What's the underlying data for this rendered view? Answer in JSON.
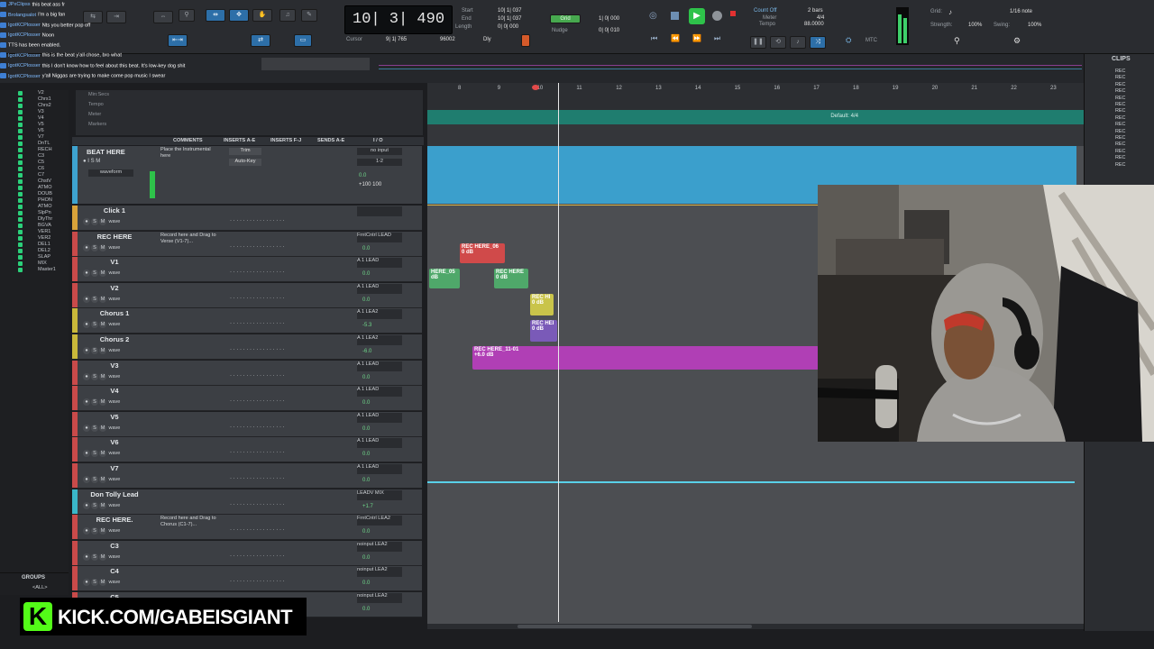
{
  "chat": [
    {
      "user": "JPxClipss",
      "msg": "this beat ass fr"
    },
    {
      "user": "Brolangsalot",
      "msg": "I'm a big fan"
    },
    {
      "user": "IgotKCPlosser",
      "msg": "Nts you better pop off"
    },
    {
      "user": "IgotKCPlosser",
      "msg": "Noon"
    },
    {
      "user": "",
      "msg": "TTS has been enabled."
    },
    {
      "user": "IgotKCPlosser",
      "msg": "this is the beat y'all chose, bro what"
    },
    {
      "user": "IgotKCPlosser",
      "msg": "this I don't know how to feel about this beat. It's low-key dog shit"
    },
    {
      "user": "IgotKCPlosser",
      "msg": "y'all Niggas are trying to make come pop music I swear"
    }
  ],
  "toolbar": {
    "counter_main": "10| 3| 490",
    "start_label": "Start",
    "end_label": "End",
    "length_label": "Length",
    "start_val": "10| 1| 037",
    "end_val": "10| 1| 037",
    "length_val": "0| 0| 000",
    "cursor_label": "Cursor",
    "cursor_val": "9| 1| 765",
    "nudge_label": "Nudge",
    "grid_val": "1| 0| 000",
    "nudge_val": "0| 0| 010",
    "count_off": "Count Off",
    "meter_label": "Meter",
    "tempo_label": "Tempo",
    "bars": "2 bars",
    "meter_val": "4/4",
    "tempo_val": "88.0000",
    "grid_label": "Grid:",
    "grid_note": "1/16 note",
    "strength_label": "Strength:",
    "strength_val": "100%",
    "swing_label": "Swing:",
    "swing_val": "100%",
    "mtc": "MTC",
    "dly": "Dly",
    "samples": "96002"
  },
  "track_list": [
    "V2",
    "Chrs1",
    "Chrs2",
    "V3",
    "V4",
    "V5",
    "V6",
    "V7",
    "DnTL",
    "RECH",
    "C3",
    "C5",
    "C6",
    "C7",
    "ChstV",
    "ATMO",
    "DOUB",
    "PHON",
    "ATMO",
    "SlpPn",
    "DlyThr",
    "BGVA",
    "VER1",
    "VER2",
    "DEL1",
    "DEL2",
    "SLAP",
    "MIX",
    "Master1"
  ],
  "groups_label": "GROUPS",
  "groups_all": "<ALL>",
  "rulers": [
    "Min:Secs",
    "Tempo",
    "Meter",
    "Markers"
  ],
  "mix_headers": [
    "COMMENTS",
    "INSERTS A-E",
    "INSERTS F-J",
    "SENDS A-E",
    "I / O"
  ],
  "ruler_ticks": [
    "8",
    "9",
    "10",
    "11",
    "12",
    "13",
    "14",
    "15",
    "16",
    "17",
    "18",
    "19",
    "20",
    "21",
    "22",
    "23"
  ],
  "tempo_text": "Default: 4/4",
  "tracks": [
    {
      "name": "Click 1",
      "comment": "",
      "io": "",
      "vol": "",
      "color": "#d8a23a"
    },
    {
      "name": "REC HERE",
      "comment": "Record here and Drag to Verse (V1-7)...",
      "io": "FrntCntrl  LEAD",
      "vol": "0.0",
      "color": "#c94a4a"
    },
    {
      "name": "V1",
      "comment": "",
      "io": "A 1  LEAD",
      "vol": "0.0",
      "color": "#c94a4a"
    },
    {
      "name": "V2",
      "comment": "",
      "io": "A 1  LEAD",
      "vol": "0.0",
      "color": "#c94a4a"
    },
    {
      "name": "Chorus 1",
      "comment": "",
      "io": "A 1  LEA2",
      "vol": "-5.3",
      "color": "#c9b83a"
    },
    {
      "name": "Chorus 2",
      "comment": "",
      "io": "A 1  LEA2",
      "vol": "-6.0",
      "color": "#c9b83a"
    },
    {
      "name": "V3",
      "comment": "",
      "io": "A 1  LEAD",
      "vol": "0.0",
      "color": "#c94a4a"
    },
    {
      "name": "V4",
      "comment": "",
      "io": "A 1  LEAD",
      "vol": "0.0",
      "color": "#c94a4a"
    },
    {
      "name": "V5",
      "comment": "",
      "io": "A 1  LEAD",
      "vol": "0.0",
      "color": "#c94a4a"
    },
    {
      "name": "V6",
      "comment": "",
      "io": "A 1  LEAD",
      "vol": "0.0",
      "color": "#c94a4a"
    },
    {
      "name": "V7",
      "comment": "",
      "io": "A 1  LEAD",
      "vol": "0.0",
      "color": "#c94a4a"
    },
    {
      "name": "Don Tolly Lead",
      "comment": "",
      "io": "LEADV  MIX",
      "vol": "+1.7",
      "color": "#3ab7c9"
    },
    {
      "name": "REC HERE.",
      "comment": "Record here and Drag to Chorus (C1-7)...",
      "io": "FrntCntrl  LEA2",
      "vol": "0.0",
      "color": "#c94a4a"
    },
    {
      "name": "C3",
      "comment": "",
      "io": "noinput  LEA2",
      "vol": "0.0",
      "color": "#c94a4a"
    },
    {
      "name": "C4",
      "comment": "",
      "io": "noinput  LEA2",
      "vol": "0.0",
      "color": "#c94a4a"
    },
    {
      "name": "C5",
      "comment": "",
      "io": "noinput  LEA2",
      "vol": "0.0",
      "color": "#c94a4a"
    }
  ],
  "beat_track": {
    "name": "BEAT HERE",
    "comment": "Place the Instrumental here",
    "ins1": "Trim",
    "ins2": "Auto-Key",
    "io1": "no input",
    "io2": "1-2",
    "vol": "0.0",
    "pan": "+100  100"
  },
  "clips": [
    {
      "label": "REC HERE_06",
      "sub": "0 dB",
      "color": "#d04a4a"
    },
    {
      "label": "HERE_05",
      "sub": "dB",
      "color": "#4fa86a"
    },
    {
      "label": "REC HERE",
      "sub": "0 dB",
      "color": "#4fa86a"
    },
    {
      "label": "REC HI",
      "sub": "0 dB",
      "color": "#c9c44a"
    },
    {
      "label": "REC HEI",
      "sub": "0 dB",
      "color": "#7a5ab8"
    },
    {
      "label": "REC HERE_11-01",
      "sub": "+6.0 dB",
      "color": "#b03fb5"
    }
  ],
  "clips_panel": {
    "title": "CLIPS",
    "items": [
      "REC",
      "REC",
      "REC",
      "REC",
      "REC",
      "REC",
      "REC",
      "REC",
      "REC",
      "REC",
      "REC",
      "REC",
      "REC",
      "REC",
      "REC"
    ]
  },
  "kick": {
    "text": "KICK.COM/GABEISGIANT",
    "logo": "K"
  },
  "colors": {
    "accent": "#2d6fa8",
    "kick": "#53fc18",
    "beat_lane": "#3b9fcc",
    "tempo_lane": "#1f7d6f"
  }
}
